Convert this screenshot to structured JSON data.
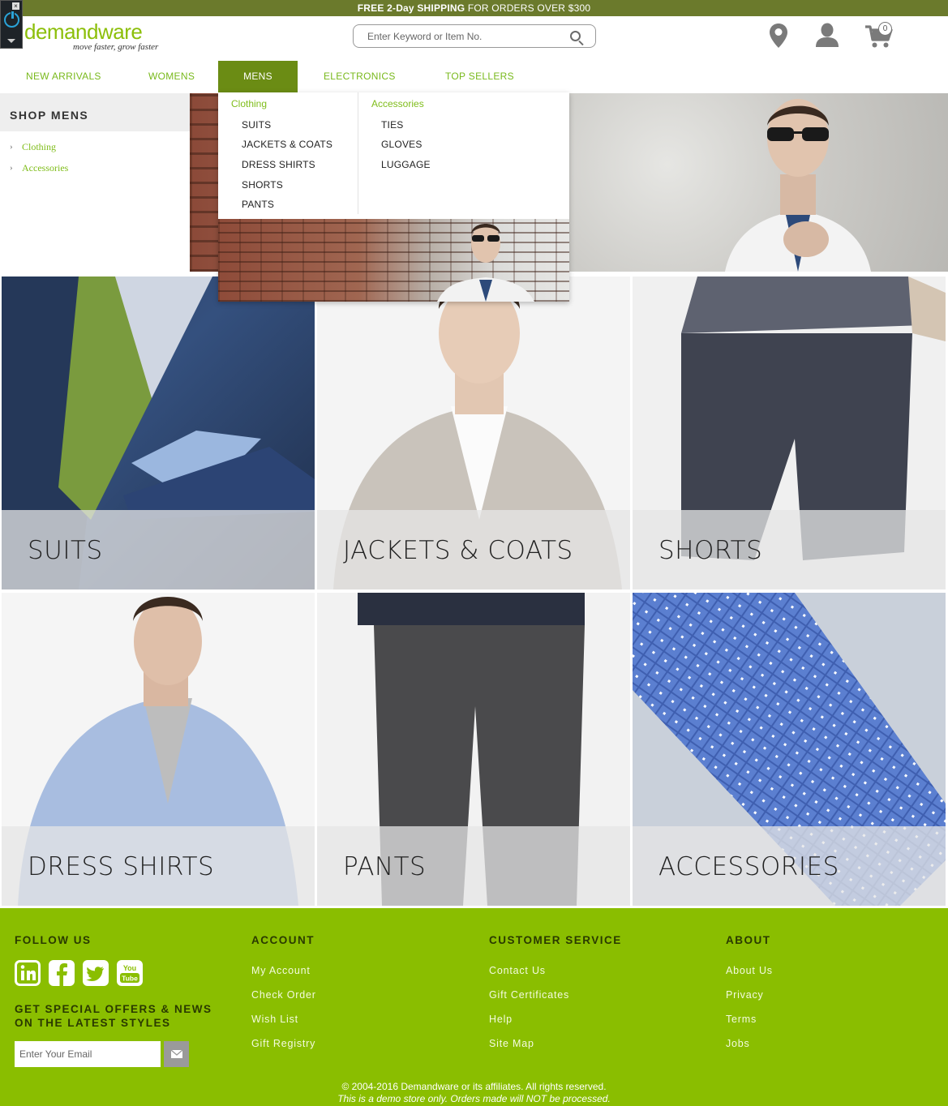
{
  "promo": {
    "bold": "FREE 2-Day SHIPPING",
    "rest": " FOR ORDERS OVER $300"
  },
  "logo": {
    "word_a": "demand",
    "word_b": "ware",
    "tagline": "move faster, grow faster"
  },
  "search": {
    "placeholder": "Enter Keyword or Item No."
  },
  "header_icons": {
    "location": "map-marker-icon",
    "account": "user-icon",
    "cart": "shopping-cart-icon",
    "cart_count": "0"
  },
  "nav": {
    "items": [
      {
        "label": "NEW ARRIVALS"
      },
      {
        "label": "WOMENS"
      },
      {
        "label": "MENS"
      },
      {
        "label": "ELECTRONICS"
      },
      {
        "label": "TOP SELLERS"
      }
    ],
    "active": "MENS"
  },
  "sidebar": {
    "title": "SHOP MENS",
    "links": [
      {
        "label": "Clothing"
      },
      {
        "label": "Accessories"
      }
    ]
  },
  "dropdown": {
    "col1": {
      "heading": "Clothing",
      "items": [
        "SUITS",
        "JACKETS & COATS",
        "DRESS SHIRTS",
        "SHORTS",
        "PANTS"
      ]
    },
    "col2": {
      "heading": "Accessories",
      "items": [
        "TIES",
        "GLOVES",
        "LUGGAGE"
      ]
    }
  },
  "tiles": [
    {
      "label": "SUITS"
    },
    {
      "label": "JACKETS & COATS"
    },
    {
      "label": "SHORTS"
    },
    {
      "label": "DRESS SHIRTS"
    },
    {
      "label": "PANTS"
    },
    {
      "label": "ACCESSORIES"
    }
  ],
  "footer": {
    "follow": {
      "heading": "FOLLOW US",
      "icons": [
        "linkedin-icon",
        "facebook-icon",
        "twitter-icon",
        "youtube-icon"
      ]
    },
    "signup": {
      "text": "GET SPECIAL OFFERS & NEWS ON THE LATEST STYLES",
      "placeholder": "Enter Your Email",
      "button_icon": "envelope-icon"
    },
    "account": {
      "heading": "ACCOUNT",
      "links": [
        "My Account",
        "Check Order",
        "Wish List",
        "Gift Registry"
      ]
    },
    "service": {
      "heading": "CUSTOMER SERVICE",
      "links": [
        "Contact Us",
        "Gift Certificates",
        "Help",
        "Site Map"
      ]
    },
    "about": {
      "heading": "ABOUT",
      "links": [
        "About Us",
        "Privacy",
        "Terms",
        "Jobs"
      ]
    },
    "copyright": "© 2004-2016 Demandware or its affiliates. All rights reserved.",
    "demo_notice": "This is a demo store only. Orders made will NOT be processed."
  },
  "colors": {
    "brand_green": "#8abe00",
    "promo_bar": "#6b7a2c",
    "nav_active": "#6b8c14",
    "link_green": "#79b91c"
  }
}
